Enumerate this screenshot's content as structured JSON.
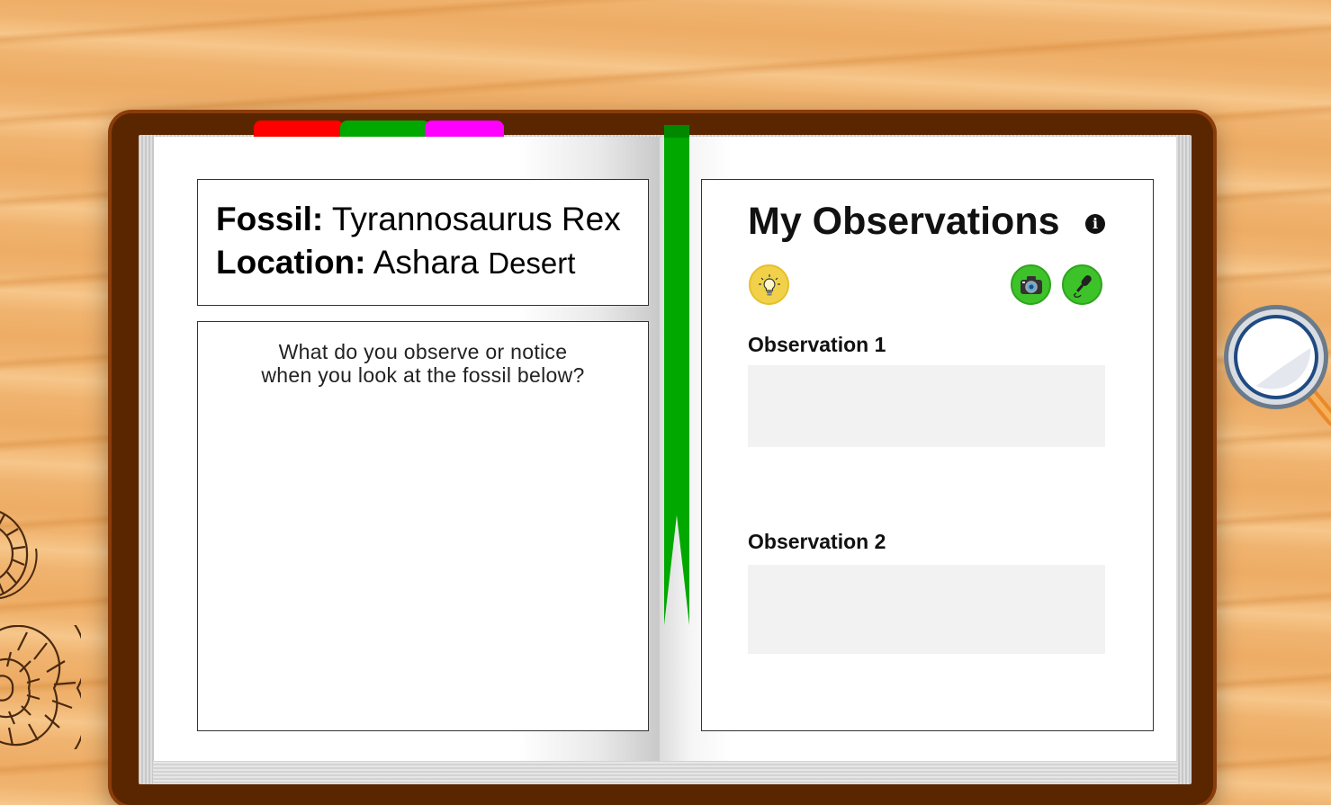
{
  "notebook": {
    "tabs": [
      "red",
      "green",
      "magenta"
    ],
    "tab_colors": {
      "red": "#ff0000",
      "green": "#00a800",
      "magenta": "#ff00ff"
    },
    "ribbon_color": "#00a800"
  },
  "left_page": {
    "fossil_label": "Fossil:",
    "fossil_value": "Tyrannosaurus Rex",
    "location_label": "Location:",
    "location_value_1": "Ashara",
    "location_value_2": "Desert",
    "prompt_line_1": "What do you observe or notice",
    "prompt_line_2": "when you look at the fossil below?"
  },
  "right_page": {
    "title": "My Observations",
    "info_icon": "info-icon",
    "buttons": {
      "hint": "lightbulb-icon",
      "camera": "camera-icon",
      "microphone": "microphone-icon"
    },
    "observations": [
      {
        "label": "Observation 1",
        "value": ""
      },
      {
        "label": "Observation 2",
        "value": ""
      }
    ]
  },
  "decorations": {
    "magnifier": "magnifying-glass-icon",
    "ammonite": "ammonite-fossil-icon"
  }
}
